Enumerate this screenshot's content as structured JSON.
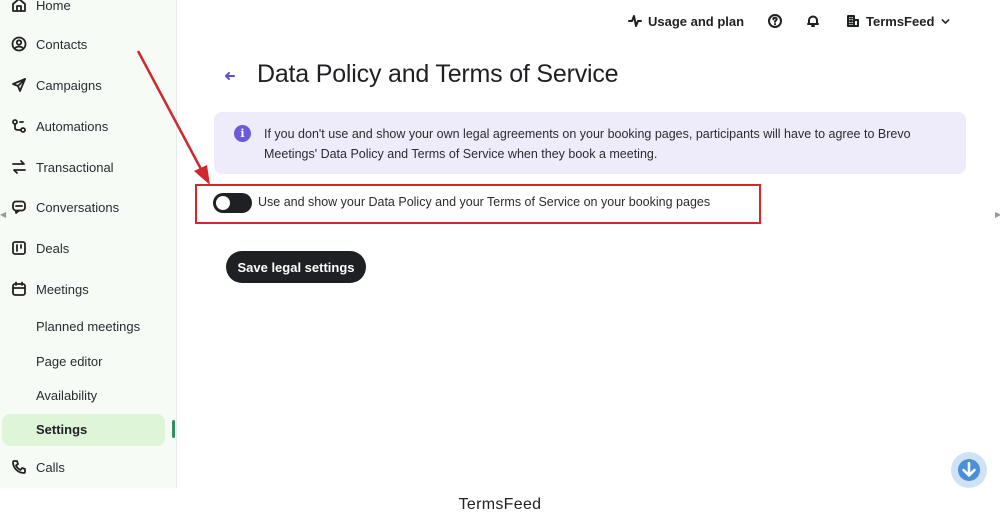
{
  "sidebar": {
    "items": [
      {
        "label": "Home",
        "icon": "home-icon"
      },
      {
        "label": "Contacts",
        "icon": "contacts-icon"
      },
      {
        "label": "Campaigns",
        "icon": "send-icon"
      },
      {
        "label": "Automations",
        "icon": "automation-icon"
      },
      {
        "label": "Transactional",
        "icon": "transfer-icon"
      },
      {
        "label": "Conversations",
        "icon": "chat-icon"
      },
      {
        "label": "Deals",
        "icon": "deals-board-icon"
      },
      {
        "label": "Meetings",
        "icon": "calendar-icon"
      }
    ],
    "meetings_sub": [
      "Planned meetings",
      "Page editor",
      "Availability",
      "Settings"
    ],
    "active_sub": "Settings",
    "calls_label": "Calls"
  },
  "topbar": {
    "usage_label": "Usage and plan",
    "account_label": "TermsFeed"
  },
  "main": {
    "title": "Data Policy and Terms of Service",
    "info_text": "If you don't use and show your own legal agreements on your booking pages, participants will have to agree to Brevo Meetings' Data Policy and Terms of Service when they book a meeting.",
    "toggle_label": "Use and show your Data Policy and your Terms of Service on your booking pages",
    "toggle_on": false,
    "save_label": "Save legal settings"
  },
  "footer": {
    "brand": "TermsFeed"
  },
  "colors": {
    "annotation_red": "#d0282e",
    "accent_purple": "#6b5bd8",
    "sidebar_active": "#dff5d8"
  }
}
